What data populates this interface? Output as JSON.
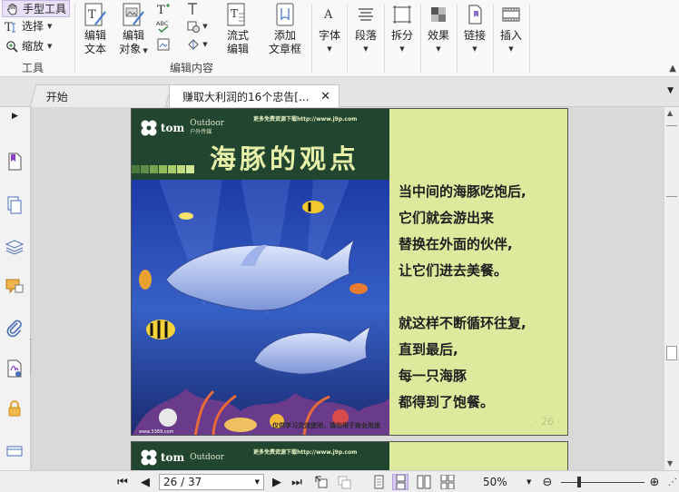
{
  "ribbon": {
    "tools": {
      "hand": "手型工具",
      "select": "选择",
      "zoom": "缩放",
      "group_label": "工具"
    },
    "edit_group_label": "编辑内容",
    "buttons": {
      "edit_text": "编辑\n文本",
      "edit_object": "编辑\n对象",
      "flow_edit": "流式\n编辑",
      "add_textbox": "添加\n文章框",
      "font": "字体",
      "paragraph": "段落",
      "split": "拆分",
      "effect": "效果",
      "link": "链接",
      "insert": "插入"
    }
  },
  "tabs": {
    "home": "开始",
    "document": "赚取大利润的16个忠告[..."
  },
  "document": {
    "page_26": {
      "header_link": "更多免费资源下载http://www.j9p.com",
      "logo_brand": "tom",
      "logo_sub": "Outdoor",
      "logo_sub2": "户外传媒",
      "title": "海豚的观点",
      "poem_a": [
        "当中间的海豚吃饱后,",
        "它们就会游出来",
        "替换在外面的伙伴,",
        "让它们进去美餐。"
      ],
      "poem_b": [
        "就这样不断循环往复,",
        "直到最后,",
        "每一只海豚",
        "都得到了饱餐。"
      ],
      "page_number": "· 26 ·",
      "footer": "仅供学习交流使用，请勿用于商业用途",
      "art_signature": "www.3389.com"
    },
    "page_27": {
      "header_link": "更多免费资源下载http://www.j9p.com",
      "logo_brand": "tom",
      "logo_sub": "Outdoor"
    }
  },
  "statusbar": {
    "page_indicator": "26 / 37",
    "current_page": 26,
    "total_pages": 37,
    "zoom": "50%",
    "zoom_percent": 50
  },
  "colors": {
    "page_bg": "#dfe99e",
    "header_green": "#21452e",
    "title_color": "#e6f0a8",
    "accent_purple": "#d8c9f0"
  }
}
